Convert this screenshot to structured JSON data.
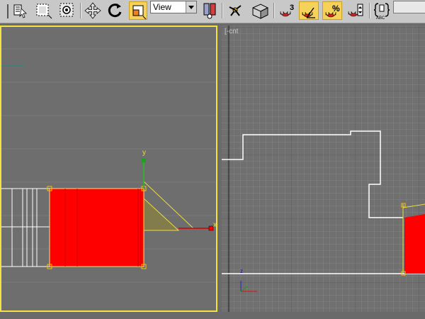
{
  "toolbar": {
    "coordinate_system": {
      "value": "View"
    },
    "icons": [
      "select-by-name-icon",
      "select-region-icon",
      "window-crossing-icon",
      "select-move-icon",
      "select-rotate-icon",
      "select-scale-icon",
      "pivot-center-icon",
      "manipulate-icon",
      "keyboard-shortcut-icon",
      "snap-3d-icon",
      "angle-snap-icon",
      "percent-snap-icon",
      "spinner-snap-icon",
      "edit-named-selections-icon"
    ]
  },
  "viewports": {
    "left": {
      "active": true,
      "gizmo": {
        "x_label": "x",
        "y_label": "y"
      }
    },
    "right": {
      "label": "[-cnt",
      "gizmo": {
        "z_label": "z"
      }
    }
  },
  "colors": {
    "active_border": "#f4e242",
    "selected_object": "#ff0000",
    "toolbar_active": "#f6d25a"
  }
}
